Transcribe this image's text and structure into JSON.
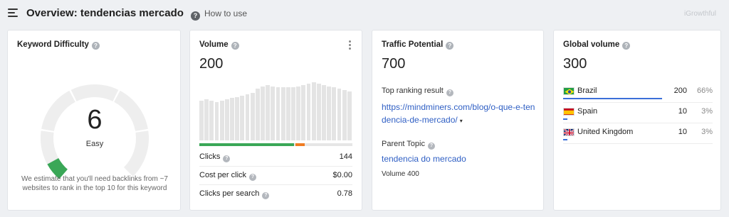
{
  "header": {
    "title": "Overview: tendencias mercado",
    "how_to_use": "How to use",
    "watermark": "iGrowthful",
    "help_glyph": "?"
  },
  "keyword_difficulty": {
    "title": "Keyword Difficulty",
    "value": "6",
    "label": "Easy",
    "gauge_level": 6,
    "gauge_max": 100,
    "level_color": "#3aa757",
    "description": "We estimate that you'll need backlinks from ~7 websites to rank in the top 10 for this keyword"
  },
  "volume": {
    "title": "Volume",
    "value": "200",
    "history_relative": [
      60,
      62,
      60,
      58,
      60,
      62,
      64,
      66,
      68,
      70,
      72,
      78,
      82,
      84,
      82,
      80,
      80,
      80,
      80,
      82,
      84,
      86,
      88,
      86,
      84,
      82,
      80,
      78,
      76,
      74
    ],
    "click_split": {
      "organic_pct": 62,
      "paid_pct": 4,
      "no_click_pct": 34
    },
    "colors": {
      "organic": "#3aa757",
      "paid": "#f07c22",
      "none": "#e6e6e6"
    },
    "metrics": [
      {
        "label": "Clicks",
        "value": "144"
      },
      {
        "label": "Cost per click",
        "value": "$0.00"
      },
      {
        "label": "Clicks per search",
        "value": "0.78"
      }
    ]
  },
  "traffic_potential": {
    "title": "Traffic Potential",
    "value": "700",
    "top_ranking_label": "Top ranking result",
    "top_ranking_url": "https://mindminers.com/blog/o-que-e-tendencia-de-mercado/",
    "caret": "▾",
    "parent_topic_label": "Parent Topic",
    "parent_topic": "tendencia do mercado",
    "parent_volume": "Volume 400"
  },
  "global_volume": {
    "title": "Global volume",
    "value": "300",
    "countries": [
      {
        "name": "Brazil",
        "volume": "200",
        "percent": "66%",
        "share": 66,
        "flag": "brazil-flag"
      },
      {
        "name": "Spain",
        "volume": "10",
        "percent": "3%",
        "share": 3,
        "flag": "spain-flag"
      },
      {
        "name": "United Kingdom",
        "volume": "10",
        "percent": "3%",
        "share": 3,
        "flag": "uk-flag"
      }
    ]
  }
}
